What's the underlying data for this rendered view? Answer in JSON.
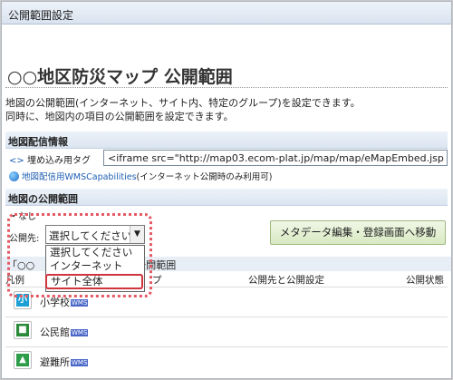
{
  "window": {
    "title": "公開範囲設定"
  },
  "page": {
    "title": "○○地区防災マップ 公開範囲",
    "description": [
      "地図の公開範囲(インターネット、サイト内、特定のグループ)を設定できます。",
      "同時に、地図内の項目の公開範囲を設定できます。"
    ]
  },
  "distribution": {
    "header": "地図配信情報",
    "embed_label": "埋め込み用タグ",
    "embed_value": "<iframe src=\"http://map03.ecom-plat.jp/map/map/eMapEmbed.jsp",
    "wms_link": "地図配信用WMSCapabilities",
    "wms_note": "(インターネット公開時のみ利用可)"
  },
  "scope": {
    "header": "地図の公開範囲",
    "current": "・なし",
    "select_label": "公開先:",
    "select_value": "選択してください",
    "options": [
      "選択してください",
      "インターネット",
      "サイト全体"
    ],
    "highlighted_option": "サイト全体",
    "meta_button": "メタデータ編集・登録画面へ移動"
  },
  "layers": {
    "title_prefix": "「○○",
    "title_suffix": "公開範囲",
    "columns": {
      "legend": "凡例",
      "name": "プ",
      "target": "公開先と公開設定",
      "status": "公開状態"
    },
    "rows": [
      {
        "name": "小学校",
        "icon_text": "小",
        "color": "#1c9fd4"
      },
      {
        "name": "公民館",
        "icon_text": "■",
        "color": "#2a8a3a"
      },
      {
        "name": "避難所",
        "icon_text": "▲",
        "color": "#2e9d4a"
      }
    ],
    "wms_badge": "WMS"
  }
}
